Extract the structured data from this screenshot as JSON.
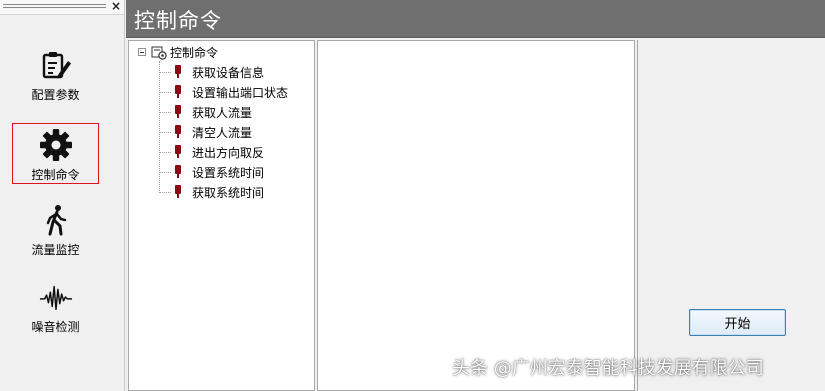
{
  "nav": {
    "close_glyph": "×",
    "items": [
      {
        "label": "配置参数",
        "icon": "config-clipboard-icon"
      },
      {
        "label": "控制命令",
        "icon": "gear-icon",
        "active": true
      },
      {
        "label": "流量监控",
        "icon": "walking-person-icon"
      },
      {
        "label": "噪音检测",
        "icon": "waveform-icon"
      }
    ]
  },
  "header": {
    "title": "控制命令"
  },
  "tree": {
    "root_label": "控制命令",
    "items": [
      {
        "label": "获取设备信息"
      },
      {
        "label": "设置输出端口状态"
      },
      {
        "label": "获取人流量"
      },
      {
        "label": "清空人流量"
      },
      {
        "label": "进出方向取反"
      },
      {
        "label": "设置系统时间"
      },
      {
        "label": "获取系统时间"
      }
    ]
  },
  "side": {
    "start_label": "开始"
  },
  "watermark": {
    "text": "头条 @广州宏泰智能科技发展有限公司"
  },
  "colors": {
    "active_border": "#e0141c",
    "titlebar": "#6f6f6f",
    "leaf_icon": "#8b0a14",
    "button_border": "#3c7fb1"
  }
}
